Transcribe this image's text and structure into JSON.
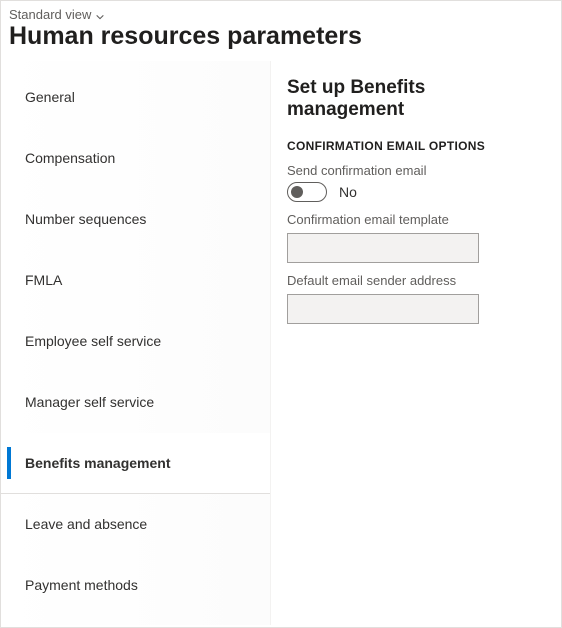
{
  "header": {
    "view_label": "Standard view",
    "page_title": "Human resources parameters"
  },
  "sidebar": {
    "items": [
      {
        "label": "General",
        "selected": false
      },
      {
        "label": "Compensation",
        "selected": false
      },
      {
        "label": "Number sequences",
        "selected": false
      },
      {
        "label": "FMLA",
        "selected": false
      },
      {
        "label": "Employee self service",
        "selected": false
      },
      {
        "label": "Manager self service",
        "selected": false
      },
      {
        "label": "Benefits management",
        "selected": true
      },
      {
        "label": "Leave and absence",
        "selected": false
      },
      {
        "label": "Payment methods",
        "selected": false
      }
    ]
  },
  "main": {
    "section_title": "Set up Benefits management",
    "subsection_title": "CONFIRMATION EMAIL OPTIONS",
    "send_confirmation_label": "Send confirmation email",
    "send_confirmation_value": "No",
    "send_confirmation_on": false,
    "template_label": "Confirmation email template",
    "template_value": "",
    "sender_label": "Default email sender address",
    "sender_value": ""
  }
}
